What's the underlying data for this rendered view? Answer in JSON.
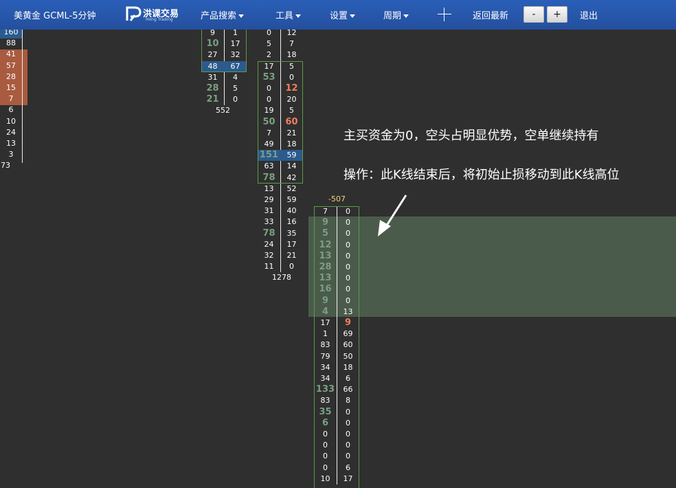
{
  "toolbar": {
    "symbol": "美黄金 GCML-5分钟",
    "product_search": "产品搜索",
    "tools": "工具",
    "settings": "设置",
    "period": "周期",
    "back_latest": "返回最新",
    "zoom_out": "-",
    "zoom_in": "+",
    "exit": "退出"
  },
  "logo": {
    "text": "洪课交易",
    "subtext": "Hong Trading"
  },
  "annotations": {
    "line1": "主买资金为0，空头占明显优势，空单继续持有",
    "line2": "操作：此K线结束后，将初始止损移动到此K线高位"
  },
  "bars": [
    {
      "left_values": [
        "160",
        "88",
        "41",
        "57",
        "28",
        "15",
        "7",
        "6",
        "10",
        "24",
        "13",
        "3"
      ],
      "bottom_total": "73"
    },
    {
      "rows": [
        {
          "l": "9",
          "r": "1"
        },
        {
          "l": "10",
          "r": "17",
          "lc": "g"
        },
        {
          "l": "27",
          "r": "32"
        },
        {
          "l": "48",
          "r": "67"
        },
        {
          "l": "31",
          "r": "4"
        },
        {
          "l": "28",
          "r": "5",
          "lc": "g"
        },
        {
          "l": "21",
          "r": "0",
          "lc": "g"
        }
      ],
      "total": "552"
    },
    {
      "rows": [
        {
          "l": "0",
          "r": "12"
        },
        {
          "l": "5",
          "r": "7"
        },
        {
          "l": "2",
          "r": "18"
        },
        {
          "l": "17",
          "r": "5"
        },
        {
          "l": "53",
          "r": "0",
          "lc": "g"
        },
        {
          "l": "0",
          "r": "12",
          "rc": "r"
        },
        {
          "l": "0",
          "r": "20"
        },
        {
          "l": "19",
          "r": "5"
        },
        {
          "l": "50",
          "r": "60",
          "lc": "g",
          "rc": "r"
        },
        {
          "l": "7",
          "r": "21"
        },
        {
          "l": "49",
          "r": "18"
        },
        {
          "l": "151",
          "r": "59",
          "lc": "g"
        },
        {
          "l": "63",
          "r": "14"
        },
        {
          "l": "78",
          "r": "42",
          "lc": "g"
        },
        {
          "l": "13",
          "r": "52"
        },
        {
          "l": "29",
          "r": "59"
        },
        {
          "l": "31",
          "r": "40"
        },
        {
          "l": "33",
          "r": "16"
        },
        {
          "l": "78",
          "r": "35",
          "lc": "g"
        },
        {
          "l": "24",
          "r": "17"
        },
        {
          "l": "32",
          "r": "21"
        },
        {
          "l": "11",
          "r": "0"
        }
      ],
      "total": "1278"
    },
    {
      "header": "-507",
      "rows": [
        {
          "l": "7",
          "r": "0"
        },
        {
          "l": "9",
          "r": "0",
          "lc": "g"
        },
        {
          "l": "5",
          "r": "0",
          "lc": "g"
        },
        {
          "l": "12",
          "r": "0",
          "lc": "g"
        },
        {
          "l": "13",
          "r": "0",
          "lc": "g"
        },
        {
          "l": "28",
          "r": "0",
          "lc": "g"
        },
        {
          "l": "13",
          "r": "0",
          "lc": "g"
        },
        {
          "l": "16",
          "r": "0",
          "lc": "g"
        },
        {
          "l": "9",
          "r": "0",
          "lc": "g"
        },
        {
          "l": "4",
          "r": "13",
          "lc": "g"
        },
        {
          "l": "17",
          "r": "9",
          "rc": "r"
        },
        {
          "l": "1",
          "r": "69"
        },
        {
          "l": "83",
          "r": "60"
        },
        {
          "l": "79",
          "r": "50"
        },
        {
          "l": "34",
          "r": "18"
        },
        {
          "l": "34",
          "r": "6"
        },
        {
          "l": "133",
          "r": "66",
          "lc": "g"
        },
        {
          "l": "83",
          "r": "8"
        },
        {
          "l": "35",
          "r": "0",
          "lc": "g"
        },
        {
          "l": "6",
          "r": "0",
          "lc": "g"
        },
        {
          "l": "0",
          "r": "0"
        },
        {
          "l": "0",
          "r": "0"
        },
        {
          "l": "0",
          "r": "0"
        },
        {
          "l": "0",
          "r": "6"
        },
        {
          "l": "10",
          "r": "17"
        }
      ]
    }
  ],
  "colors": {
    "background": "#2f2f2f",
    "toolbar": "#2a5fb8",
    "buy_green": "#7a9f82",
    "sell_red": "#ef7f5e",
    "box_border": "#5b9b4a",
    "highlight_blue": "#2b5a8e",
    "highlight_orange": "#a85b3f",
    "zone_green": "rgba(130,175,130,0.35)"
  }
}
